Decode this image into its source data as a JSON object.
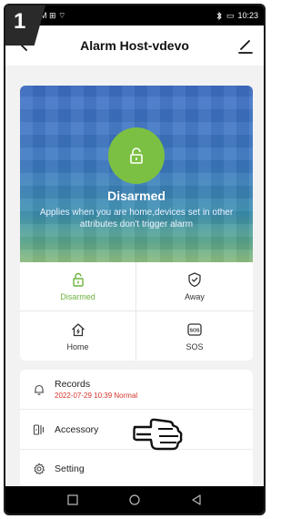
{
  "step": {
    "number": "1"
  },
  "status_bar": {
    "left": "M ⊞ ⌔",
    "time": "10:23",
    "battery": "▭"
  },
  "header": {
    "title": "Alarm Host-vdevo"
  },
  "security": {
    "state": "Disarmed",
    "description": "Applies when you are home,devices set in other attributes  don't trigger alarm",
    "modes": [
      {
        "label": "Disarmed",
        "icon": "unlock-icon",
        "active": true
      },
      {
        "label": "Away",
        "icon": "shield-check-icon",
        "active": false
      },
      {
        "label": "Home",
        "icon": "home-icon",
        "active": false
      },
      {
        "label": "SOS",
        "icon": "sos-icon",
        "active": false
      }
    ]
  },
  "menu": {
    "items": [
      {
        "label": "Records",
        "sub": "2022-07-29 10:39 Normal",
        "icon": "bell-icon"
      },
      {
        "label": "Accessory",
        "icon": "device-icon"
      },
      {
        "label": "Setting",
        "icon": "gear-icon"
      }
    ]
  },
  "colors": {
    "accent_green": "#7cc043",
    "record_red": "#d6332b"
  }
}
